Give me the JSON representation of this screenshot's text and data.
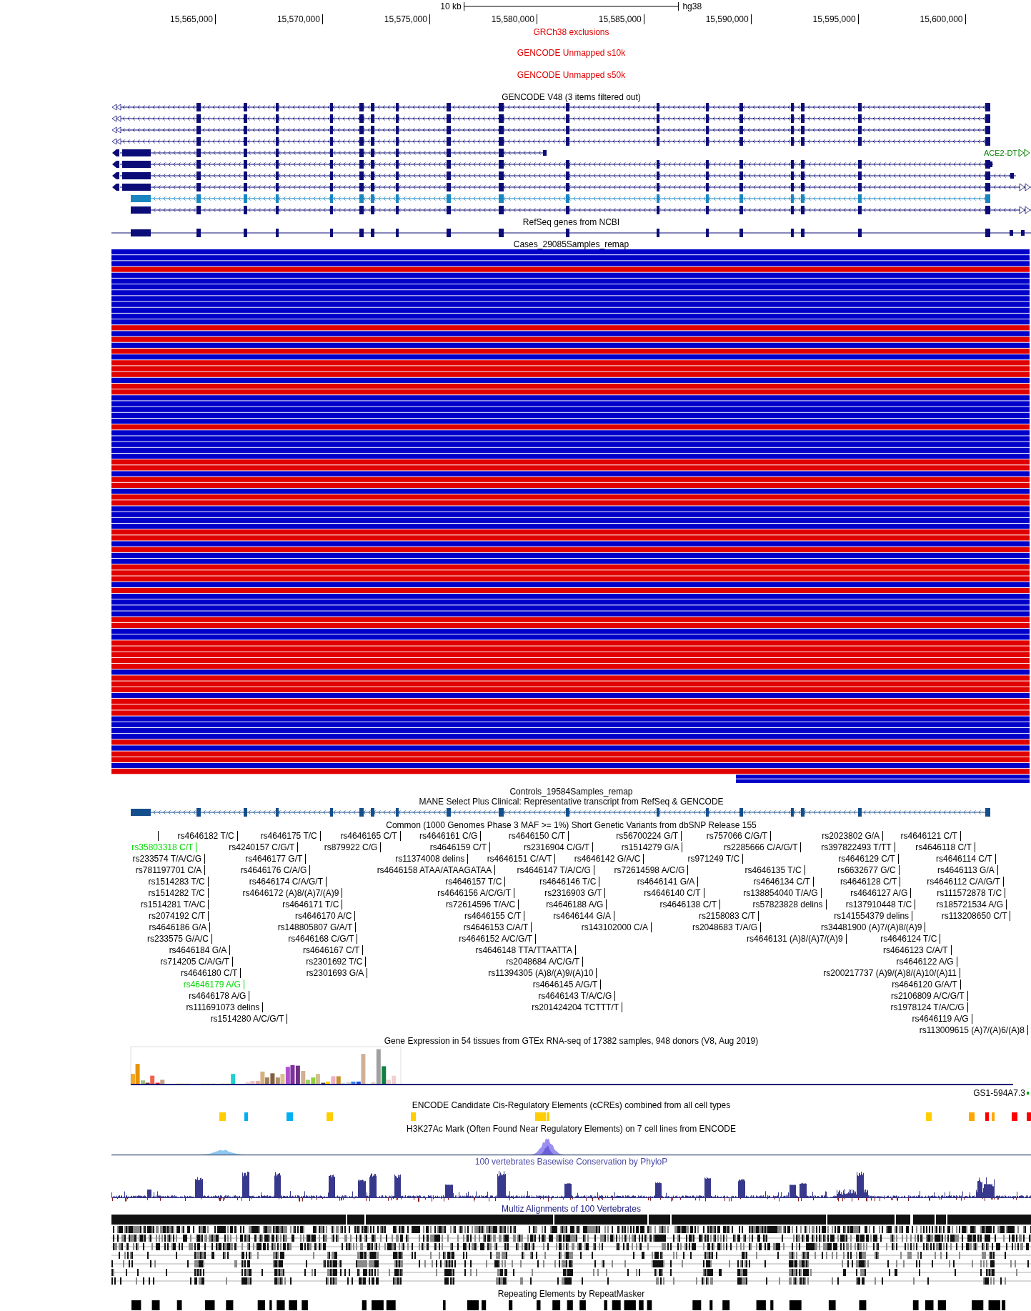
{
  "ruler": {
    "scale_label": "10 kb",
    "assembly": "hg38",
    "ticks": [
      {
        "label": "15,565,000"
      },
      {
        "label": "15,570,000"
      },
      {
        "label": "15,575,000"
      },
      {
        "label": "15,580,000"
      },
      {
        "label": "15,585,000"
      },
      {
        "label": "15,590,000"
      },
      {
        "label": "15,595,000"
      },
      {
        "label": "15,600,000"
      }
    ]
  },
  "tracks": [
    {
      "kind": "empty",
      "title": "GRCh38 exclusions"
    },
    {
      "kind": "empty",
      "title": "GENCODE Unmapped s10k"
    },
    {
      "kind": "empty",
      "title": "GENCODE Unmapped s50k"
    },
    {
      "kind": "gencode",
      "title": "GENCODE V48 (3 items filtered out)",
      "gene_label": "ACE2-DT"
    },
    {
      "kind": "refseq",
      "title": "RefSeq genes from NCBI"
    },
    {
      "kind": "samples",
      "title": "Cases_29085Samples_remap",
      "bars": [
        {
          "kind": "full",
          "color": "#0000c8"
        },
        {
          "kind": "full",
          "color": "#0000c8"
        },
        {
          "kind": "full",
          "color": "#0000c8"
        },
        {
          "kind": "full",
          "color": "#e00000"
        },
        {
          "kind": "full",
          "color": "#0000c8"
        },
        {
          "kind": "full",
          "color": "#0000c8"
        },
        {
          "kind": "full",
          "color": "#0000c8"
        },
        {
          "kind": "full",
          "color": "#0000c8"
        },
        {
          "kind": "full",
          "color": "#0000c8"
        },
        {
          "kind": "full",
          "color": "#0000c8"
        },
        {
          "kind": "full",
          "color": "#0000c8"
        },
        {
          "kind": "full",
          "color": "#0000c8"
        },
        {
          "kind": "full",
          "color": "#0000c8"
        },
        {
          "kind": "full",
          "color": "#e00000"
        },
        {
          "kind": "full",
          "color": "#0000c8"
        },
        {
          "kind": "full",
          "color": "#e00000"
        },
        {
          "kind": "full",
          "color": "#0000c8"
        },
        {
          "kind": "full",
          "color": "#e00000"
        },
        {
          "kind": "full",
          "color": "#0000c8"
        },
        {
          "kind": "full",
          "color": "#e00000"
        },
        {
          "kind": "full",
          "color": "#e00000"
        },
        {
          "kind": "full",
          "color": "#e00000"
        },
        {
          "kind": "full",
          "color": "#0000c8"
        },
        {
          "kind": "full",
          "color": "#e00000"
        },
        {
          "kind": "full",
          "color": "#e00000"
        },
        {
          "kind": "full",
          "color": "#0000c8"
        },
        {
          "kind": "full",
          "color": "#0000c8"
        },
        {
          "kind": "full",
          "color": "#0000c8"
        },
        {
          "kind": "full",
          "color": "#0000c8"
        },
        {
          "kind": "full",
          "color": "#0000c8"
        },
        {
          "kind": "full",
          "color": "#e00000"
        },
        {
          "kind": "full",
          "color": "#0000c8"
        },
        {
          "kind": "full",
          "color": "#0000c8"
        },
        {
          "kind": "full",
          "color": "#0000c8"
        },
        {
          "kind": "full",
          "color": "#0000c8"
        },
        {
          "kind": "full",
          "color": "#0000c8"
        },
        {
          "kind": "full",
          "color": "#e00000"
        },
        {
          "kind": "full",
          "color": "#e00000"
        },
        {
          "kind": "full",
          "color": "#0000c8"
        },
        {
          "kind": "full",
          "color": "#e00000"
        },
        {
          "kind": "full",
          "color": "#e00000"
        },
        {
          "kind": "full",
          "color": "#0000c8"
        },
        {
          "kind": "full",
          "color": "#e00000"
        },
        {
          "kind": "full",
          "color": "#e00000"
        },
        {
          "kind": "full",
          "color": "#0000c8"
        },
        {
          "kind": "full",
          "color": "#0000c8"
        },
        {
          "kind": "full",
          "color": "#0000c8"
        },
        {
          "kind": "full",
          "color": "#0000c8"
        },
        {
          "kind": "full",
          "color": "#e00000"
        },
        {
          "kind": "full",
          "color": "#e00000"
        },
        {
          "kind": "full",
          "color": "#0000c8"
        },
        {
          "kind": "full",
          "color": "#e00000"
        },
        {
          "kind": "full",
          "color": "#0000c8"
        },
        {
          "kind": "full",
          "color": "#0000c8"
        },
        {
          "kind": "full",
          "color": "#e00000"
        },
        {
          "kind": "full",
          "color": "#e00000"
        },
        {
          "kind": "full",
          "color": "#e00000"
        },
        {
          "kind": "full",
          "color": "#0000c8"
        },
        {
          "kind": "full",
          "color": "#e00000"
        },
        {
          "kind": "full",
          "color": "#0000c8"
        },
        {
          "kind": "full",
          "color": "#0000c8"
        },
        {
          "kind": "full",
          "color": "#0000c8"
        },
        {
          "kind": "full",
          "color": "#0000c8"
        },
        {
          "kind": "full",
          "color": "#e00000"
        },
        {
          "kind": "full",
          "color": "#e00000"
        },
        {
          "kind": "full",
          "color": "#0000c8"
        },
        {
          "kind": "full",
          "color": "#0000c8"
        },
        {
          "kind": "full",
          "color": "#e00000"
        },
        {
          "kind": "full",
          "color": "#e00000"
        },
        {
          "kind": "full",
          "color": "#e00000"
        },
        {
          "kind": "full",
          "color": "#e00000"
        },
        {
          "kind": "full",
          "color": "#e00000"
        },
        {
          "kind": "full",
          "color": "#0000c8"
        },
        {
          "kind": "full",
          "color": "#e00000"
        },
        {
          "kind": "full",
          "color": "#e00000"
        },
        {
          "kind": "full",
          "color": "#e00000"
        },
        {
          "kind": "full",
          "color": "#0000c8"
        },
        {
          "kind": "full",
          "color": "#e00000"
        },
        {
          "kind": "full",
          "color": "#e00000"
        },
        {
          "kind": "full",
          "color": "#e00000"
        },
        {
          "kind": "full",
          "color": "#0000c8"
        },
        {
          "kind": "full",
          "color": "#0000c8"
        },
        {
          "kind": "full",
          "color": "#0000c8"
        },
        {
          "kind": "full",
          "color": "#0000c8"
        },
        {
          "kind": "full",
          "color": "#e00000"
        },
        {
          "kind": "full",
          "color": "#0000c8"
        },
        {
          "kind": "full",
          "color": "#e00000"
        },
        {
          "kind": "full",
          "color": "#e00000"
        },
        {
          "kind": "full",
          "color": "#0000c8"
        },
        {
          "kind": "full",
          "color": "#e00000"
        },
        {
          "kind": "partial",
          "color": "#0000c8"
        },
        {
          "kind": "partial",
          "color": "#0000c8"
        }
      ]
    },
    {
      "kind": "title_only",
      "title": "Controls_19584Samples_remap"
    },
    {
      "kind": "mane",
      "title": "MANE Select Plus Clinical: Representative transcript from RefSeq & GENCODE"
    },
    {
      "kind": "snps",
      "title": "Common (1000 Genomes Phase 3 MAF >= 1%) Short Genetic Variants from dbSNP Release 155",
      "rows": [
        {
          "variants": [
            {
              "highlighted": false
            },
            {
              "label": "rs4646182 T/C",
              "highlighted": false
            },
            {
              "label": "rs4646175 T/C",
              "highlighted": false
            },
            {
              "label": "rs4646165 C/T",
              "highlighted": false
            },
            {
              "label": "rs4646161 C/G",
              "highlighted": false
            },
            {
              "label": "rs4646150 C/T",
              "highlighted": false
            },
            {
              "label": "rs56700224 G/T",
              "highlighted": false
            },
            {
              "label": "rs757066 C/G/T",
              "highlighted": false
            },
            {
              "label": "rs2023802 G/A",
              "highlighted": false
            },
            {
              "label": "rs4646121 C/T",
              "highlighted": false
            }
          ]
        },
        {
          "variants": [
            {
              "label": "rs35803318 C/T",
              "highlighted": true
            },
            {
              "label": "rs4240157 C/G/T",
              "highlighted": false
            },
            {
              "label": "rs879922 C/G",
              "highlighted": false
            },
            {
              "label": "rs4646159 C/T",
              "highlighted": false
            },
            {
              "label": "rs2316904 C/G/T",
              "highlighted": false
            },
            {
              "label": "rs1514279 G/A",
              "highlighted": false
            },
            {
              "label": "rs2285666 C/A/G/T",
              "highlighted": false
            },
            {
              "label": "rs397822493 T/TT",
              "highlighted": false
            },
            {
              "label": "rs4646118 C/T",
              "highlighted": false
            }
          ]
        },
        {
          "variants": [
            {
              "label": "rs233574 T/A/C/G",
              "highlighted": false
            },
            {
              "label": "rs4646177 G/T",
              "highlighted": false
            },
            {
              "label": "rs11374008 delins",
              "highlighted": false
            },
            {
              "label": "rs4646151 C/A/T",
              "highlighted": false
            },
            {
              "label": "rs4646142 G/A/C",
              "highlighted": false
            },
            {
              "label": "rs971249 T/C",
              "highlighted": false
            },
            {
              "label": "rs4646129 C/T",
              "highlighted": false
            },
            {
              "label": "rs4646114 C/T",
              "highlighted": false
            }
          ]
        },
        {
          "variants": [
            {
              "label": "rs781197701 C/A",
              "highlighted": false
            },
            {
              "label": "rs4646176 C/A/G",
              "highlighted": false
            },
            {
              "label": "rs4646158 ATAA/ATAAGATAA",
              "highlighted": false
            },
            {
              "label": "rs4646147 T/A/C/G",
              "highlighted": false
            },
            {
              "label": "rs72614598 A/C/G",
              "highlighted": false
            },
            {
              "label": "rs4646135 T/C",
              "highlighted": false
            },
            {
              "label": "rs6632677 G/C",
              "highlighted": false
            },
            {
              "label": "rs4646113 G/A",
              "highlighted": false
            }
          ]
        },
        {
          "variants": [
            {
              "label": "rs1514283 T/C",
              "highlighted": false
            },
            {
              "label": "rs4646174 C/A/G/T",
              "highlighted": false
            },
            {
              "label": "rs4646157 T/C",
              "highlighted": false
            },
            {
              "label": "rs4646146 T/C",
              "highlighted": false
            },
            {
              "label": "rs4646141 G/A",
              "highlighted": false
            },
            {
              "label": "rs4646134 C/T",
              "highlighted": false
            },
            {
              "label": "rs4646128 C/T",
              "highlighted": false
            },
            {
              "label": "rs4646112 C/A/G/T",
              "highlighted": false
            }
          ]
        },
        {
          "variants": [
            {
              "label": "rs1514282 T/C",
              "highlighted": false
            },
            {
              "label": "rs4646172 (A)8/(A)7/(A)9",
              "highlighted": false
            },
            {
              "label": "rs4646156 A/C/G/T",
              "highlighted": false
            },
            {
              "label": "rs2316903 G/T",
              "highlighted": false
            },
            {
              "label": "rs4646140 C/T",
              "highlighted": false
            },
            {
              "label": "rs138854040 T/A/G",
              "highlighted": false
            },
            {
              "label": "rs4646127 A/G",
              "highlighted": false
            },
            {
              "label": "rs111572878 T/C",
              "highlighted": false
            }
          ]
        },
        {
          "variants": [
            {
              "label": "rs1514281 T/A/C",
              "highlighted": false
            },
            {
              "label": "rs4646171 T/C",
              "highlighted": false
            },
            {
              "label": "rs72614596 T/A/C",
              "highlighted": false
            },
            {
              "label": "rs4646188 A/G",
              "highlighted": false
            },
            {
              "label": "rs4646138 C/T",
              "highlighted": false
            },
            {
              "label": "rs57823828 delins",
              "highlighted": false
            },
            {
              "label": "rs137910448 T/C",
              "highlighted": false
            },
            {
              "label": "rs185721534 A/G",
              "highlighted": false
            }
          ]
        },
        {
          "variants": [
            {
              "label": "rs2074192 C/T",
              "highlighted": false
            },
            {
              "label": "rs4646170 A/C",
              "highlighted": false
            },
            {
              "label": "rs4646155 C/T",
              "highlighted": false
            },
            {
              "label": "rs4646144 G/A",
              "highlighted": false
            },
            {
              "label": "rs2158083 C/T",
              "highlighted": false
            },
            {
              "label": "rs141554379 delins",
              "highlighted": false
            },
            {
              "label": "rs113208650 C/T",
              "highlighted": false
            }
          ]
        },
        {
          "variants": [
            {
              "label": "rs4646186 G/A",
              "highlighted": false
            },
            {
              "label": "rs148805807 G/A/T",
              "highlighted": false
            },
            {
              "label": "rs4646153 C/A/T",
              "highlighted": false
            },
            {
              "label": "rs143102000 C/A",
              "highlighted": false
            },
            {
              "label": "rs2048683 T/A/G",
              "highlighted": false
            },
            {
              "label": "rs34481900 (A)7/(A)8/(A)9",
              "highlighted": false
            }
          ]
        },
        {
          "variants": [
            {
              "label": "rs233575 G/A/C",
              "highlighted": false
            },
            {
              "label": "rs4646168 C/G/T",
              "highlighted": false
            },
            {
              "label": "rs4646152 A/C/G/T",
              "highlighted": false
            },
            {
              "label": "rs4646131 (A)8/(A)7/(A)9",
              "highlighted": false
            },
            {
              "label": "rs4646124 T/C",
              "highlighted": false
            }
          ]
        },
        {
          "variants": [
            {
              "label": "rs4646184 G/A",
              "highlighted": false
            },
            {
              "label": "rs4646167 C/T",
              "highlighted": false
            },
            {
              "label": "rs4646148 TTA/TTAATTA",
              "highlighted": false
            },
            {
              "label": "rs4646123 C/A/T",
              "highlighted": false
            }
          ]
        },
        {
          "variants": [
            {
              "label": "rs714205 C/A/G/T",
              "highlighted": false
            },
            {
              "label": "rs2301692 T/C",
              "highlighted": false
            },
            {
              "label": "rs2048684 A/C/G/T",
              "highlighted": false
            },
            {
              "label": "rs4646122 A/G",
              "highlighted": false
            }
          ]
        },
        {
          "variants": [
            {
              "label": "rs4646180 C/T",
              "highlighted": false
            },
            {
              "label": "rs2301693 G/A",
              "highlighted": false
            },
            {
              "label": "rs11394305 (A)8/(A)9/(A)10",
              "highlighted": false
            },
            {
              "label": "rs200217737 (A)9/(A)8/(A)10/(A)11",
              "highlighted": false
            }
          ]
        },
        {
          "variants": [
            {
              "label": "rs4646179 A/G",
              "highlighted": true
            },
            {
              "label": "rs4646145 A/G/T",
              "highlighted": false
            },
            {
              "label": "rs4646120 G/A/T",
              "highlighted": false
            }
          ]
        },
        {
          "variants": [
            {
              "label": "rs4646178 A/G",
              "highlighted": false
            },
            {
              "label": "rs4646143 T/A/C/G",
              "highlighted": false
            },
            {
              "label": "rs2106809 A/C/G/T",
              "highlighted": false
            }
          ]
        },
        {
          "variants": [
            {
              "label": "rs111691073 delins",
              "highlighted": false
            },
            {
              "label": "rs201424204 TCTTT/T",
              "highlighted": false
            },
            {
              "label": "rs1978124 T/A/C/G",
              "highlighted": false
            }
          ]
        },
        {
          "variants": [
            {
              "label": "rs1514280 A/C/G/T",
              "highlighted": false
            },
            {
              "label": "rs4646119 A/G",
              "highlighted": false
            }
          ]
        },
        {
          "variants": [
            {
              "label": "rs113009615 (A)7/(A)6/(A)8",
              "highlighted": false
            }
          ]
        }
      ]
    },
    {
      "kind": "gtex",
      "title": "Gene Expression in 54 tissues from GTEx RNA-seq of 17382 samples, 948 donors (V8, Aug 2019)",
      "gene_label": "GS1-594A7.3"
    },
    {
      "kind": "ccre",
      "title": "ENCODE Candidate Cis-Regulatory Elements (cCREs) combined from all cell types"
    },
    {
      "kind": "h3k27ac",
      "title": "H3K27Ac Mark (Often Found Near Regulatory Elements) on 7 cell lines from ENCODE"
    },
    {
      "kind": "phylop",
      "title": "100 vertebrates Basewise Conservation by PhyloP"
    },
    {
      "kind": "multiz",
      "title": "Multiz Alignments of 100 Vertebrates"
    },
    {
      "kind": "repeats",
      "title": "Repeating Elements by RepeatMasker"
    }
  ]
}
